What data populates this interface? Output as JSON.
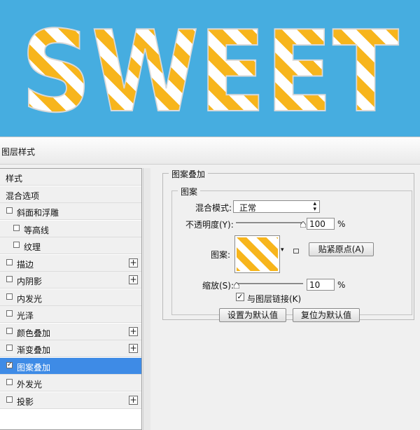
{
  "canvas": {
    "text": "SWEET",
    "bg_color": "#46ade0",
    "stripe_color": "#f7b51c"
  },
  "dialog": {
    "title": "图层样式"
  },
  "sidebar": {
    "items": [
      {
        "label": "样式",
        "checkbox": false,
        "checked": false,
        "plus": false
      },
      {
        "label": "混合选项",
        "checkbox": false,
        "checked": false,
        "plus": false
      },
      {
        "label": "斜面和浮雕",
        "checkbox": true,
        "checked": false,
        "plus": false
      },
      {
        "label": "等高线",
        "checkbox": true,
        "checked": false,
        "plus": false
      },
      {
        "label": "纹理",
        "checkbox": true,
        "checked": false,
        "plus": false
      },
      {
        "label": "描边",
        "checkbox": true,
        "checked": false,
        "plus": true
      },
      {
        "label": "内阴影",
        "checkbox": true,
        "checked": false,
        "plus": true
      },
      {
        "label": "内发光",
        "checkbox": true,
        "checked": false,
        "plus": false
      },
      {
        "label": "光泽",
        "checkbox": true,
        "checked": false,
        "plus": false
      },
      {
        "label": "颜色叠加",
        "checkbox": true,
        "checked": false,
        "plus": true
      },
      {
        "label": "渐变叠加",
        "checkbox": true,
        "checked": false,
        "plus": true
      },
      {
        "label": "图案叠加",
        "checkbox": true,
        "checked": true,
        "plus": false,
        "selected": true
      },
      {
        "label": "外发光",
        "checkbox": true,
        "checked": false,
        "plus": false
      },
      {
        "label": "投影",
        "checkbox": true,
        "checked": false,
        "plus": true
      }
    ]
  },
  "panel": {
    "group_title": "图案叠加",
    "subgroup_title": "图案",
    "blend_mode_label": "混合模式:",
    "blend_mode_value": "正常",
    "opacity_label": "不透明度(Y):",
    "opacity_value": "100",
    "opacity_unit": "%",
    "pattern_label": "图案:",
    "snap_button": "贴紧原点(A)",
    "scale_label": "缩放(S):",
    "scale_value": "10",
    "scale_unit": "%",
    "link_label": "与图层链接(K)",
    "link_checked": true,
    "default_button": "设置为默认值",
    "reset_button": "复位为默认值"
  }
}
